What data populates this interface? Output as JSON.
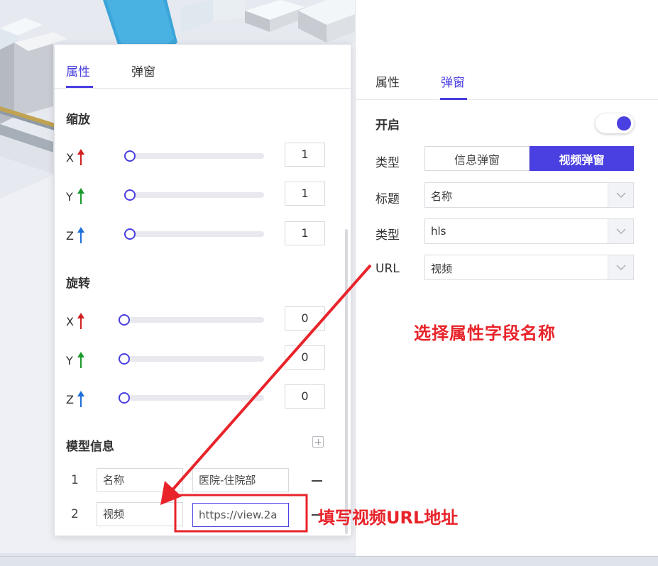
{
  "left_panel": {
    "tabs": [
      {
        "label": "属性",
        "active": true
      },
      {
        "label": "弹窗",
        "active": false
      }
    ],
    "scale": {
      "title": "缩放",
      "axes": [
        {
          "label": "X",
          "value": "1",
          "arrow_color": "#d11e1e"
        },
        {
          "label": "Y",
          "value": "1",
          "arrow_color": "#1a9a2a"
        },
        {
          "label": "Z",
          "value": "1",
          "arrow_color": "#1e6fd9"
        }
      ]
    },
    "rotation": {
      "title": "旋转",
      "axes": [
        {
          "label": "X",
          "value": "0",
          "arrow_color": "#d11e1e"
        },
        {
          "label": "Y",
          "value": "0",
          "arrow_color": "#1a9a2a"
        },
        {
          "label": "Z",
          "value": "0",
          "arrow_color": "#1e6fd9"
        }
      ]
    },
    "model_info": {
      "title": "模型信息",
      "rows": [
        {
          "index": "1",
          "key": "名称",
          "value": "医院-住院部"
        },
        {
          "index": "2",
          "key": "视频",
          "value": "https://view.2a"
        }
      ]
    }
  },
  "right_panel": {
    "tabs": [
      {
        "label": "属性",
        "active": false
      },
      {
        "label": "弹窗",
        "active": true
      }
    ],
    "enable_label": "开启",
    "enabled": true,
    "type_label": "类型",
    "type_options": [
      {
        "label": "信息弹窗",
        "selected": false
      },
      {
        "label": "视频弹窗",
        "selected": true
      }
    ],
    "fields": [
      {
        "label": "标题",
        "value": "名称"
      },
      {
        "label": "类型",
        "value": "hls"
      },
      {
        "label": "URL",
        "value": "视频"
      }
    ]
  },
  "annotations": {
    "select_field": "选择属性字段名称",
    "fill_url": "填写视频URL地址",
    "color": "#e8232a"
  },
  "colors": {
    "accent": "#4a3fe0"
  }
}
